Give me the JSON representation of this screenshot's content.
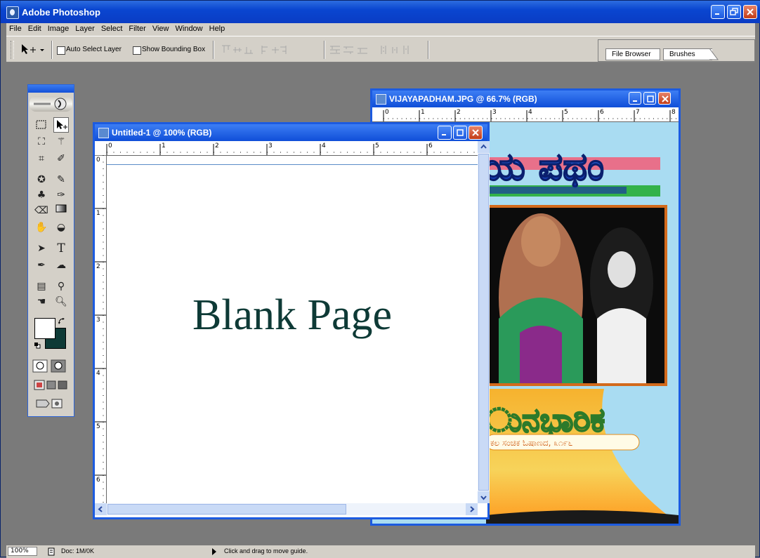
{
  "app": {
    "title": "Adobe Photoshop"
  },
  "menu": [
    "File",
    "Edit",
    "Image",
    "Layer",
    "Select",
    "Filter",
    "View",
    "Window",
    "Help"
  ],
  "options": {
    "auto_select_label": "Auto Select Layer",
    "show_bbox_label": "Show Bounding Box",
    "palette_tabs": [
      "File Browser",
      "Brushes"
    ]
  },
  "documents": {
    "untitled": {
      "title": "Untitled-1 @ 100% (RGB)",
      "canvas_text": "Blank Page",
      "ruler_numbers": [
        "0",
        "1",
        "2",
        "3",
        "4",
        "5",
        "6"
      ],
      "vruler_numbers": [
        "0",
        "1",
        "2",
        "3",
        "4",
        "5",
        "6"
      ]
    },
    "vijaya": {
      "title": "VIJAYAPADHAM.JPG @ 66.7% (RGB)",
      "ruler_numbers": [
        "0",
        "1",
        "2",
        "3",
        "4",
        "5",
        "6",
        "7",
        "8"
      ]
    }
  },
  "status": {
    "zoom": "100%",
    "doc": "Doc: 1M/0K",
    "hint": "Click and drag to move guide."
  },
  "colors": {
    "xp_blue": "#0a46d0",
    "workspace": "#7a7a7a",
    "canvas_text": "#0e3a36",
    "foreground": "#0e3a36",
    "background": "#ffffff"
  },
  "icons": [
    "move-tool-icon",
    "marquee-icon",
    "lasso-icon",
    "magic-wand-icon",
    "crop-icon",
    "slice-icon",
    "healing-icon",
    "brush-icon",
    "stamp-icon",
    "history-brush-icon",
    "eraser-icon",
    "gradient-icon",
    "blur-icon",
    "dodge-icon",
    "path-select-icon",
    "type-icon",
    "pen-icon",
    "shape-icon",
    "notes-icon",
    "eyedropper-icon",
    "hand-icon",
    "zoom-icon"
  ]
}
